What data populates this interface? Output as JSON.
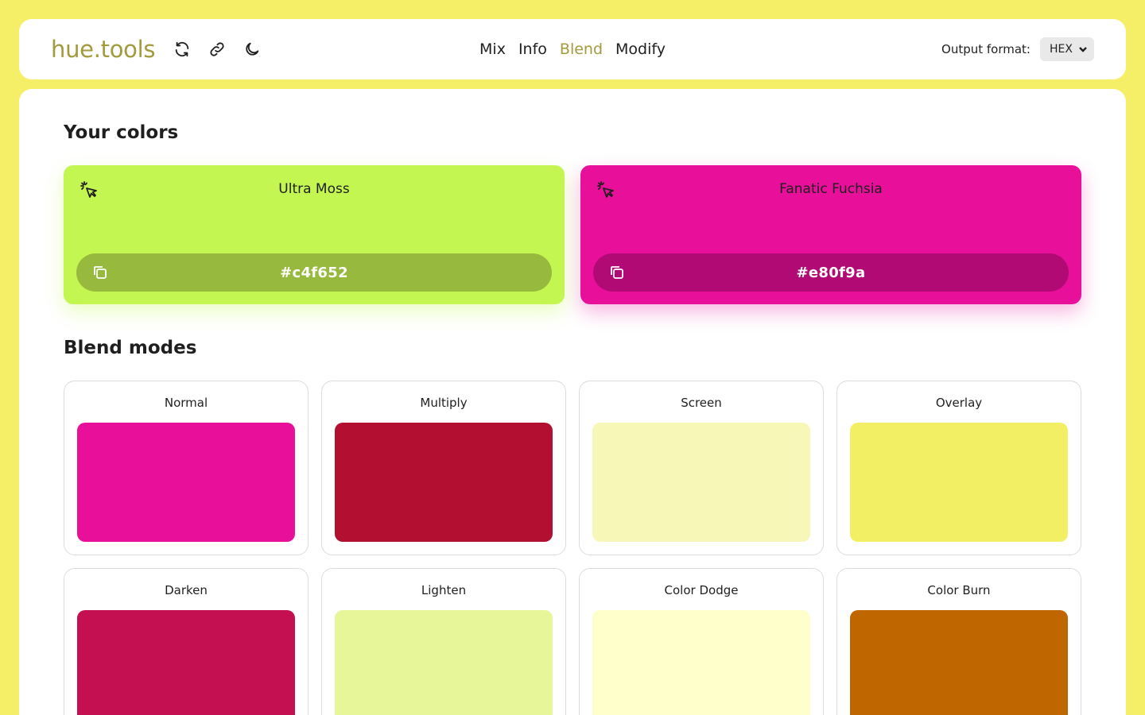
{
  "app": {
    "logo": "hue.tools"
  },
  "toolbar": {
    "icons": [
      "refresh-icon",
      "link-icon",
      "moon-icon"
    ]
  },
  "nav": {
    "items": [
      {
        "label": "Mix",
        "active": false
      },
      {
        "label": "Info",
        "active": false
      },
      {
        "label": "Blend",
        "active": true
      },
      {
        "label": "Modify",
        "active": false
      }
    ]
  },
  "output": {
    "label": "Output format:",
    "value": "HEX"
  },
  "sections": {
    "colors_title": "Your colors",
    "blend_title": "Blend modes"
  },
  "colors": [
    {
      "name": "Ultra Moss",
      "hex": "#c4f652",
      "bar_color": "#97b93d"
    },
    {
      "name": "Fanatic Fuchsia",
      "hex": "#e80f9a",
      "bar_color": "#b20a75"
    }
  ],
  "blend_modes": [
    {
      "name": "Normal",
      "color": "#e80f9a"
    },
    {
      "name": "Multiply",
      "color": "#b30f31"
    },
    {
      "name": "Screen",
      "color": "#f7f7b7"
    },
    {
      "name": "Overlay",
      "color": "#f2ef64"
    },
    {
      "name": "Darken",
      "color": "#c40f50"
    },
    {
      "name": "Lighten",
      "color": "#e6f699"
    },
    {
      "name": "Color Dodge",
      "color": "#ffffcc"
    },
    {
      "name": "Color Burn",
      "color": "#bf6600"
    }
  ]
}
